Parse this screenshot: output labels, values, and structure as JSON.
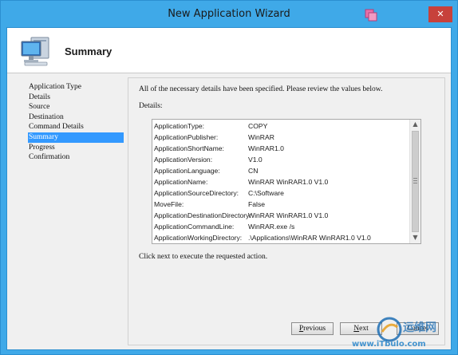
{
  "window": {
    "title": "New Application Wizard",
    "close_glyph": "✕"
  },
  "header": {
    "title": "Summary",
    "icon": "computer-icon"
  },
  "nav": {
    "items": [
      {
        "label": "Application Type",
        "active": false
      },
      {
        "label": "Details",
        "active": false
      },
      {
        "label": "Source",
        "active": false
      },
      {
        "label": "Destination",
        "active": false
      },
      {
        "label": "Command Details",
        "active": false
      },
      {
        "label": "Summary",
        "active": true
      },
      {
        "label": "Progress",
        "active": false
      },
      {
        "label": "Confirmation",
        "active": false
      }
    ]
  },
  "content": {
    "intro": "All of the necessary details have been specified.  Please review the values below.",
    "details_label": "Details:",
    "rows": [
      {
        "key": "ApplicationType:",
        "value": "COPY"
      },
      {
        "key": "ApplicationPublisher:",
        "value": "WinRAR"
      },
      {
        "key": "ApplicationShortName:",
        "value": "WinRAR1.0"
      },
      {
        "key": "ApplicationVersion:",
        "value": "V1.0"
      },
      {
        "key": "ApplicationLanguage:",
        "value": "CN"
      },
      {
        "key": "ApplicationName:",
        "value": "WinRAR WinRAR1.0 V1.0"
      },
      {
        "key": "ApplicationSourceDirectory:",
        "value": "C:\\Software"
      },
      {
        "key": "MoveFile:",
        "value": "False"
      },
      {
        "key": "ApplicationDestinationDirectory:",
        "value": "WinRAR WinRAR1.0 V1.0"
      },
      {
        "key": "ApplicationCommandLine:",
        "value": "WinRAR.exe /s"
      },
      {
        "key": "ApplicationWorkingDirectory:",
        "value": ".\\Applications\\WinRAR WinRAR1.0 V1.0"
      }
    ],
    "hint": "Click next to execute the requested action."
  },
  "buttons": {
    "previous_mnemonic": "P",
    "previous_rest": "revious",
    "next_mnemonic": "N",
    "next_rest": "ext",
    "cancel": "Cancel"
  },
  "watermark": {
    "text": "运维网",
    "url": "www.iTbulo.com",
    "colors": {
      "blue": "#1f6fb5"
    }
  },
  "colors": {
    "titlebar": "#3fa9e8",
    "close_button": "#c7413b",
    "selection": "#3399ff"
  }
}
